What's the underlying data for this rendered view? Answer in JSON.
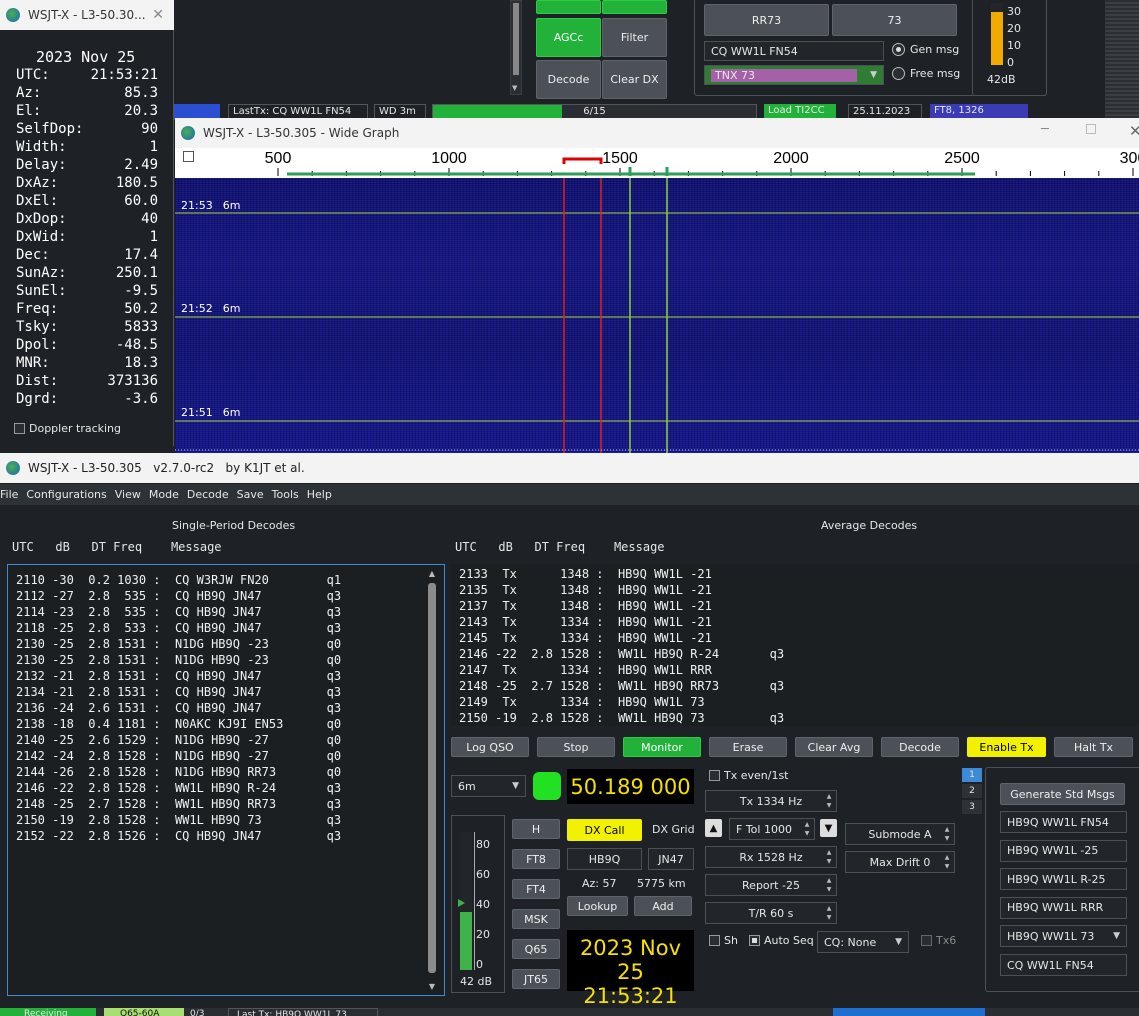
{
  "astro": {
    "title": "WSJT-X - L3-50.30...",
    "date": "2023 Nov 25",
    "rows": [
      {
        "label": "UTC:",
        "value": "21:53:21"
      },
      {
        "label": "Az:",
        "value": "85.3"
      },
      {
        "label": "El:",
        "value": "20.3"
      },
      {
        "label": "SelfDop:",
        "value": "90"
      },
      {
        "label": "Width:",
        "value": "1"
      },
      {
        "label": "Delay:",
        "value": "2.49"
      },
      {
        "label": "DxAz:",
        "value": "180.5"
      },
      {
        "label": "DxEl:",
        "value": "60.0"
      },
      {
        "label": "DxDop:",
        "value": "40"
      },
      {
        "label": "DxWid:",
        "value": "1"
      },
      {
        "label": "Dec:",
        "value": "17.4"
      },
      {
        "label": "SunAz:",
        "value": "250.1"
      },
      {
        "label": "SunEl:",
        "value": "-9.5"
      },
      {
        "label": "Freq:",
        "value": "50.2"
      },
      {
        "label": "Tsky:",
        "value": "5833"
      },
      {
        "label": "Dpol:",
        "value": "-48.5"
      },
      {
        "label": "MNR:",
        "value": "18.3"
      },
      {
        "label": "Dist:",
        "value": "373136"
      },
      {
        "label": "Dgrd:",
        "value": "-3.6"
      }
    ],
    "doppler": "Doppler tracking"
  },
  "bg_window": {
    "btn_agcc": "AGCc",
    "btn_filter": "Filter",
    "btn_decode": "Decode",
    "btn_cleardx": "Clear DX",
    "btn_rr73": "RR73",
    "btn_73": "73",
    "cq_field": "CQ WW1L FN54",
    "tnx_field": "TNX 73",
    "gen_msg": "Gen msg",
    "free_msg": "Free msg",
    "meter_ticks": [
      "30",
      "20",
      "10",
      "0"
    ],
    "meter_db": "42dB",
    "meter_level": 0.85,
    "status": [
      "LastTx: CQ WW1L FN54",
      "WD 3m",
      "6/15",
      "Load TI2CC",
      "25.11.2023",
      "FT8, 1326"
    ],
    "progress": 0.4
  },
  "wide_graph": {
    "title": "WSJT-X - L3-50.305 - Wide Graph",
    "freq_ticks": [
      "500",
      "1000",
      "1500",
      "2000",
      "2500",
      "300"
    ],
    "rows": [
      {
        "time": "21:53",
        "band": "6m"
      },
      {
        "time": "21:52",
        "band": "6m"
      },
      {
        "time": "21:51",
        "band": "6m"
      }
    ]
  },
  "main": {
    "title": "WSJT-X - L3-50.305   v2.7.0-rc2   by K1JT et al.",
    "menu": [
      "File",
      "Configurations",
      "View",
      "Mode",
      "Decode",
      "Save",
      "Tools",
      "Help"
    ],
    "single_title": "Single-Period Decodes",
    "average_title": "Average Decodes",
    "header_left": "UTC   dB   DT Freq    Message",
    "header_right": "UTC   dB   DT Freq    Message",
    "single_lines": [
      "2110 -30  0.2 1030 :  CQ W3RJW FN20        q1",
      "2112 -27  2.8  535 :  CQ HB9Q JN47         q3",
      "2114 -23  2.8  535 :  CQ HB9Q JN47         q3",
      "2118 -25  2.8  533 :  CQ HB9Q JN47         q3",
      "2130 -25  2.8 1531 :  N1DG HB9Q -23        q0",
      "2130 -25  2.8 1531 :  N1DG HB9Q -23        q0",
      "2132 -21  2.8 1531 :  CQ HB9Q JN47         q3",
      "2134 -21  2.8 1531 :  CQ HB9Q JN47         q3",
      "2136 -24  2.6 1531 :  CQ HB9Q JN47         q3",
      "2138 -18  0.4 1181 :  N0AKC KJ9I EN53      q0",
      "2140 -25  2.6 1529 :  N1DG HB9Q -27        q0",
      "2142 -24  2.8 1528 :  N1DG HB9Q -27        q0",
      "2144 -26  2.8 1528 :  N1DG HB9Q RR73       q0",
      "2146 -22  2.8 1528 :  WW1L HB9Q R-24       q3",
      "2148 -25  2.7 1528 :  WW1L HB9Q RR73       q3",
      "2150 -19  2.8 1528 :  WW1L HB9Q 73         q3",
      "2152 -22  2.8 1526 :  CQ HB9Q JN47         q3"
    ],
    "average_lines": [
      "2133  Tx      1348 :  HB9Q WW1L -21",
      "2135  Tx      1348 :  HB9Q WW1L -21",
      "2137  Tx      1348 :  HB9Q WW1L -21",
      "2143  Tx      1334 :  HB9Q WW1L -21",
      "2145  Tx      1334 :  HB9Q WW1L -21",
      "2146 -22  2.8 1528 :  WW1L HB9Q R-24       q3",
      "2147  Tx      1334 :  HB9Q WW1L RRR",
      "2148 -25  2.7 1528 :  WW1L HB9Q RR73       q3",
      "2149  Tx      1334 :  HB9Q WW1L 73",
      "2150 -19  2.8 1528 :  WW1L HB9Q 73         q3"
    ],
    "buttons": {
      "log_qso": "Log QSO",
      "stop": "Stop",
      "monitor": "Monitor",
      "erase": "Erase",
      "clear_avg": "Clear Avg",
      "decode": "Decode",
      "enable_tx": "Enable Tx",
      "halt_tx": "Halt Tx"
    },
    "band": "6m",
    "frequency": "50.189 000",
    "mode_buttons": [
      "H",
      "FT8",
      "FT4",
      "MSK",
      "Q65",
      "JT65"
    ],
    "dx_call_btn": "DX Call",
    "dx_grid_lbl": "DX Grid",
    "dx_call": "HB9Q",
    "dx_grid": "JN47",
    "az": "Az: 57",
    "dist": "5775 km",
    "lookup": "Lookup",
    "add": "Add",
    "clock_date": "2023 Nov 25",
    "clock_time": "21:53:21",
    "meter_ticks": [
      "80",
      "60",
      "40",
      "20",
      "0"
    ],
    "meter_db": "42 dB",
    "meter_level": 0.42,
    "tx_even": "Tx even/1st",
    "tx_hz": "Tx  1334 Hz",
    "ftol": "F Tol  1000",
    "rx_hz": "Rx  1528 Hz",
    "report": "Report -25",
    "tr": "T/R  60  s",
    "submode": "Submode A",
    "max_drift": "Max Drift  0",
    "sh": "Sh",
    "auto_seq": "Auto Seq",
    "cq_none": "CQ: None",
    "tx6": "Tx6",
    "tabs": [
      "1",
      "2",
      "3"
    ],
    "gen_std": "Generate Std Msgs",
    "tx_msgs": [
      "HB9Q WW1L FN54",
      "HB9Q WW1L -25",
      "HB9Q WW1L R-25",
      "HB9Q WW1L RRR",
      "HB9Q WW1L 73",
      "CQ WW1L FN54"
    ],
    "status": [
      "Receiving",
      "Q65-60A",
      "0/3",
      "Last Tx: HB9Q WW1L 73"
    ]
  }
}
